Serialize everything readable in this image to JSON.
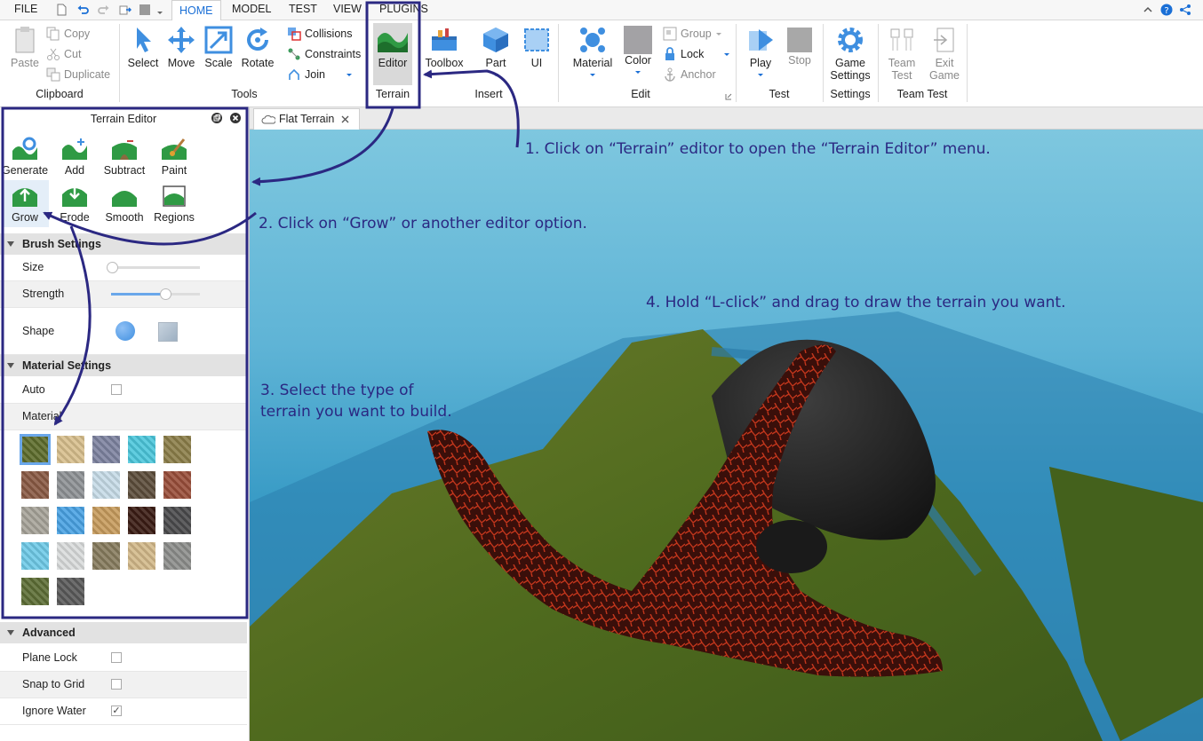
{
  "menubar": {
    "items": [
      "FILE",
      "HOME",
      "MODEL",
      "TEST",
      "VIEW",
      "PLUGINS"
    ],
    "active": "HOME"
  },
  "ribbon": {
    "clipboard": {
      "paste": "Paste",
      "copy": "Copy",
      "cut": "Cut",
      "duplicate": "Duplicate",
      "label": "Clipboard"
    },
    "tools": {
      "select": "Select",
      "move": "Move",
      "scale": "Scale",
      "rotate": "Rotate",
      "collisions": "Collisions",
      "constraints": "Constraints",
      "join": "Join",
      "label": "Tools"
    },
    "terrain": {
      "editor": "Editor",
      "label": "Terrain"
    },
    "insert": {
      "toolbox": "Toolbox",
      "part": "Part",
      "ui": "UI",
      "label": "Insert"
    },
    "edit": {
      "material": "Material",
      "color": "Color",
      "group": "Group",
      "lock": "Lock",
      "anchor": "Anchor",
      "label": "Edit"
    },
    "test": {
      "play": "Play",
      "stop": "Stop",
      "label": "Test"
    },
    "settings": {
      "game_settings_1": "Game",
      "game_settings_2": "Settings",
      "label": "Settings"
    },
    "team_test": {
      "team_test_1": "Team",
      "team_test_2": "Test",
      "exit_game_1": "Exit",
      "exit_game_2": "Game",
      "label": "Team Test"
    }
  },
  "panel": {
    "title": "Terrain Editor",
    "tools": [
      "Generate",
      "Add",
      "Subtract",
      "Paint",
      "Grow",
      "Erode",
      "Smooth",
      "Regions"
    ],
    "brush_settings": {
      "header": "Brush Settings",
      "size": "Size",
      "strength": "Strength",
      "shape": "Shape",
      "size_level": 0.0,
      "strength_level": 0.6
    },
    "material_settings": {
      "header": "Material Settings",
      "auto": "Auto",
      "material": "Material"
    },
    "advanced": {
      "header": "Advanced",
      "plane_lock": "Plane Lock",
      "snap_to_grid": "Snap to Grid",
      "ignore_water": "Ignore Water",
      "plane_lock_checked": false,
      "snap_to_grid_checked": false,
      "ignore_water_checked": true,
      "ignore_water_mark": "✓"
    }
  },
  "materials": [
    {
      "name": "grass",
      "color": "#5e6d2c"
    },
    {
      "name": "sand",
      "color": "#d8bf8d"
    },
    {
      "name": "slate",
      "color": "#7e83a0"
    },
    {
      "name": "water",
      "color": "#4cc7dc"
    },
    {
      "name": "ground",
      "color": "#8c7f4a"
    },
    {
      "name": "wood",
      "color": "#8a5a44"
    },
    {
      "name": "rock",
      "color": "#8e9295"
    },
    {
      "name": "snow",
      "color": "#c7dce8"
    },
    {
      "name": "mud",
      "color": "#5c4d3b"
    },
    {
      "name": "brick",
      "color": "#9a4e3a"
    },
    {
      "name": "concrete",
      "color": "#a7a49a"
    },
    {
      "name": "glacier",
      "color": "#4aa3e4"
    },
    {
      "name": "woodplanks",
      "color": "#c79c5d"
    },
    {
      "name": "cracked-lava",
      "color": "#3b1c14"
    },
    {
      "name": "basalt",
      "color": "#4b4b4d"
    },
    {
      "name": "ice",
      "color": "#6fcbe8"
    },
    {
      "name": "salt",
      "color": "#dadcdc"
    },
    {
      "name": "cobblestone",
      "color": "#877c5e"
    },
    {
      "name": "sandstone",
      "color": "#d3b98a"
    },
    {
      "name": "limestone",
      "color": "#8d8e8c"
    },
    {
      "name": "leafy-grass",
      "color": "#5d6e35"
    },
    {
      "name": "pavement",
      "color": "#5a5a5a"
    }
  ],
  "viewport": {
    "tab": "Flat Terrain",
    "notes": {
      "n1": "1. Click on “Terrain” editor to open the “Terrain Editor” menu.",
      "n2": "2. Click on “Grow” or another editor option.",
      "n3a": "3. Select the type of",
      "n3b": "terrain you want to build.",
      "n4": "4. Hold “L-click” and drag to draw the terrain you want."
    }
  },
  "colors": {
    "accent": "#1a6fd6",
    "annotation": "#2b2882",
    "sea": "#3f8fb5",
    "grass": "#5a6d22",
    "lava": "#8a1a10"
  }
}
